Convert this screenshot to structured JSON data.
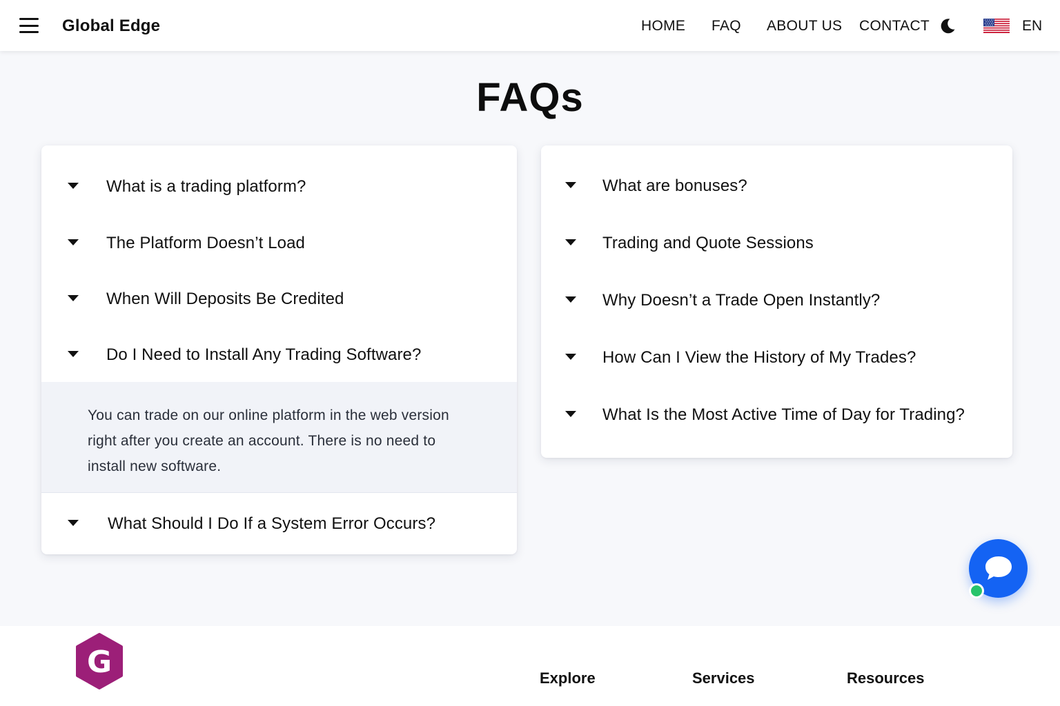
{
  "header": {
    "brand": "Global Edge",
    "nav": [
      "HOME",
      "FAQ",
      "ABOUT US",
      "CONTACT"
    ],
    "language": "EN",
    "menu_icon": "hamburger-menu-icon",
    "theme_icon": "moon-icon",
    "flag_icon": "us-flag-icon"
  },
  "page": {
    "title": "FAQs"
  },
  "faq_left": [
    "What is a trading platform?",
    "The Platform Doesn’t Load",
    "When Will Deposits Be Credited",
    "Do I Need to Install Any Trading Software?",
    "What Should I Do If a System Error Occurs?"
  ],
  "faq_left_expanded_answer": "You can trade on our online platform in the web version right after you create an account. There is no need to install new software.",
  "faq_right": [
    "What are bonuses?",
    "Trading and Quote Sessions",
    "Why Doesn’t a Trade Open Instantly?",
    "How Can I View the History of My Trades?",
    "What Is the Most Active Time of Day for Trading?"
  ],
  "chat": {
    "icon": "chat-bubble-icon",
    "status": "online"
  },
  "footer": {
    "logo_icon": "hexagon-g-logo-icon",
    "columns": [
      "Explore",
      "Services",
      "Resources"
    ]
  },
  "colors": {
    "accent": "#1463f3",
    "online": "#27c46b",
    "logo": "#9c1f78",
    "background": "#f7f8fb",
    "answer_bg": "#f1f3f8"
  }
}
